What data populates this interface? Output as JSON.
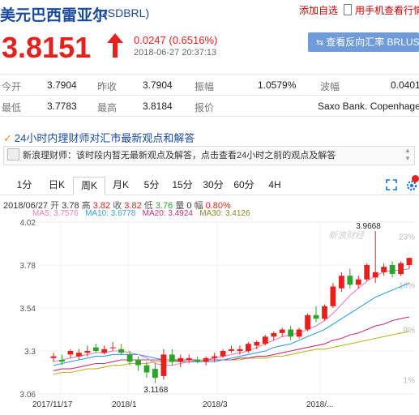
{
  "header": {
    "title": "美元巴西雷亚尔",
    "code": "(USDBRL)",
    "add_favorite": "添加自选",
    "mobile_view": "用手机查看行情"
  },
  "quote": {
    "price": "3.8151",
    "change": "0.0247 (0.6516%)",
    "time": "2018-06-27 20:37:13",
    "reverse_button": "查看反向汇率 BRLUSD"
  },
  "stats": {
    "open_label": "今开",
    "open": "3.7904",
    "prev_close_label": "昨收",
    "prev_close": "3.7904",
    "amplitude_label": "振幅",
    "amplitude": "1.0579%",
    "range_label": "波幅",
    "range": "0.0401",
    "low_label": "最低",
    "low": "3.7783",
    "high_label": "最高",
    "high": "3.8184",
    "quote_label": "报价",
    "quote_source": "Saxo Bank. Copenhager"
  },
  "news": {
    "title": "24小时内理财师对汇市最新观点和解答",
    "item": "新浪理财师：该时段内暂无最新观点及解答，点击查看24小时之前的观点及解答"
  },
  "tabs": [
    "1分",
    "日K",
    "周K",
    "月K",
    "5分",
    "15分",
    "30分",
    "60分",
    "4H"
  ],
  "active_tab": "周K",
  "chart_info": {
    "date": "2018/06/27",
    "open_label": "开",
    "open": "3.78",
    "high_label": "高",
    "high": "3.82",
    "close_label": "收",
    "close": "3.82",
    "low_label": "低",
    "low": "3.76",
    "volume_label": "量",
    "volume": "0",
    "change_label": "幅",
    "change": "0.80%",
    "ma5": "MA5: 3.7576",
    "ma10": "MA10: 3.6778",
    "ma20": "MA20: 3.4924",
    "ma30": "MA30: 3.4126"
  },
  "colors": {
    "up": "#e8201c",
    "down": "#2aa52a",
    "ma5": "#e87fbf",
    "ma10": "#3aa0e0",
    "ma20": "#c8307a",
    "ma30": "#b8b830",
    "link": "#1a4a9c"
  },
  "chart_data": {
    "type": "candlestick",
    "y_ticks": [
      "4.02",
      "3.78",
      "3.54",
      "3.3",
      "3.06"
    ],
    "y_range": [
      3.06,
      4.02
    ],
    "right_ticks": [
      "23%",
      "16%",
      "9%",
      "1%"
    ],
    "x_ticks": [
      "2017/11/17",
      "2018/1",
      "2018/3",
      "2018/..."
    ],
    "max_label": "3.9668",
    "min_label": "3.1168",
    "watermark": "新浪财经",
    "candles": [
      {
        "o": 3.26,
        "h": 3.29,
        "l": 3.24,
        "c": 3.27
      },
      {
        "o": 3.25,
        "h": 3.28,
        "l": 3.22,
        "c": 3.24
      },
      {
        "o": 3.28,
        "h": 3.31,
        "l": 3.26,
        "c": 3.3
      },
      {
        "o": 3.27,
        "h": 3.31,
        "l": 3.25,
        "c": 3.29
      },
      {
        "o": 3.29,
        "h": 3.33,
        "l": 3.27,
        "c": 3.3
      },
      {
        "o": 3.32,
        "h": 3.34,
        "l": 3.29,
        "c": 3.3
      },
      {
        "o": 3.29,
        "h": 3.33,
        "l": 3.28,
        "c": 3.31
      },
      {
        "o": 3.32,
        "h": 3.35,
        "l": 3.3,
        "c": 3.32
      },
      {
        "o": 3.31,
        "h": 3.34,
        "l": 3.28,
        "c": 3.29
      },
      {
        "o": 3.28,
        "h": 3.3,
        "l": 3.22,
        "c": 3.24
      },
      {
        "o": 3.25,
        "h": 3.27,
        "l": 3.19,
        "c": 3.22
      },
      {
        "o": 3.22,
        "h": 3.24,
        "l": 3.15,
        "c": 3.18
      },
      {
        "o": 3.2,
        "h": 3.23,
        "l": 3.12,
        "c": 3.15
      },
      {
        "o": 3.16,
        "h": 3.31,
        "l": 3.14,
        "c": 3.28
      },
      {
        "o": 3.28,
        "h": 3.31,
        "l": 3.22,
        "c": 3.24
      },
      {
        "o": 3.24,
        "h": 3.28,
        "l": 3.21,
        "c": 3.26
      },
      {
        "o": 3.25,
        "h": 3.28,
        "l": 3.23,
        "c": 3.26
      },
      {
        "o": 3.25,
        "h": 3.27,
        "l": 3.23,
        "c": 3.24
      },
      {
        "o": 3.24,
        "h": 3.27,
        "l": 3.22,
        "c": 3.26
      },
      {
        "o": 3.26,
        "h": 3.29,
        "l": 3.24,
        "c": 3.27
      },
      {
        "o": 3.27,
        "h": 3.31,
        "l": 3.26,
        "c": 3.3
      },
      {
        "o": 3.3,
        "h": 3.33,
        "l": 3.29,
        "c": 3.31
      },
      {
        "o": 3.3,
        "h": 3.33,
        "l": 3.28,
        "c": 3.31
      },
      {
        "o": 3.3,
        "h": 3.35,
        "l": 3.29,
        "c": 3.34
      },
      {
        "o": 3.33,
        "h": 3.36,
        "l": 3.31,
        "c": 3.35
      },
      {
        "o": 3.34,
        "h": 3.39,
        "l": 3.33,
        "c": 3.38
      },
      {
        "o": 3.38,
        "h": 3.41,
        "l": 3.36,
        "c": 3.4
      },
      {
        "o": 3.4,
        "h": 3.43,
        "l": 3.38,
        "c": 3.42
      },
      {
        "o": 3.42,
        "h": 3.44,
        "l": 3.36,
        "c": 3.38
      },
      {
        "o": 3.38,
        "h": 3.43,
        "l": 3.37,
        "c": 3.42
      },
      {
        "o": 3.42,
        "h": 3.51,
        "l": 3.41,
        "c": 3.5
      },
      {
        "o": 3.5,
        "h": 3.55,
        "l": 3.46,
        "c": 3.48
      },
      {
        "o": 3.48,
        "h": 3.56,
        "l": 3.47,
        "c": 3.55
      },
      {
        "o": 3.55,
        "h": 3.68,
        "l": 3.54,
        "c": 3.66
      },
      {
        "o": 3.65,
        "h": 3.74,
        "l": 3.63,
        "c": 3.72
      },
      {
        "o": 3.72,
        "h": 3.76,
        "l": 3.65,
        "c": 3.67
      },
      {
        "o": 3.67,
        "h": 3.72,
        "l": 3.65,
        "c": 3.7
      },
      {
        "o": 3.7,
        "h": 3.79,
        "l": 3.69,
        "c": 3.78
      },
      {
        "o": 3.71,
        "h": 3.97,
        "l": 3.68,
        "c": 3.74
      },
      {
        "o": 3.74,
        "h": 3.79,
        "l": 3.72,
        "c": 3.77
      },
      {
        "o": 3.78,
        "h": 3.8,
        "l": 3.71,
        "c": 3.73
      },
      {
        "o": 3.73,
        "h": 3.8,
        "l": 3.72,
        "c": 3.79
      },
      {
        "o": 3.78,
        "h": 3.82,
        "l": 3.76,
        "c": 3.82
      }
    ],
    "ma5": [
      3.24,
      3.25,
      3.26,
      3.27,
      3.28,
      3.29,
      3.29,
      3.3,
      3.3,
      3.29,
      3.28,
      3.26,
      3.23,
      3.22,
      3.22,
      3.23,
      3.24,
      3.25,
      3.25,
      3.26,
      3.27,
      3.28,
      3.29,
      3.3,
      3.32,
      3.34,
      3.36,
      3.38,
      3.39,
      3.4,
      3.42,
      3.44,
      3.47,
      3.51,
      3.56,
      3.61,
      3.65,
      3.69,
      3.72,
      3.74,
      3.75,
      3.75,
      3.76
    ],
    "ma10": [
      3.22,
      3.23,
      3.24,
      3.25,
      3.26,
      3.27,
      3.27,
      3.28,
      3.28,
      3.28,
      3.28,
      3.27,
      3.26,
      3.25,
      3.25,
      3.24,
      3.24,
      3.24,
      3.24,
      3.24,
      3.25,
      3.26,
      3.27,
      3.28,
      3.29,
      3.3,
      3.32,
      3.33,
      3.34,
      3.36,
      3.38,
      3.4,
      3.42,
      3.45,
      3.48,
      3.51,
      3.54,
      3.57,
      3.6,
      3.62,
      3.64,
      3.66,
      3.68
    ],
    "ma20": [
      3.19,
      3.2,
      3.2,
      3.21,
      3.22,
      3.23,
      3.23,
      3.24,
      3.25,
      3.25,
      3.25,
      3.25,
      3.25,
      3.25,
      3.25,
      3.25,
      3.25,
      3.25,
      3.25,
      3.25,
      3.25,
      3.25,
      3.26,
      3.26,
      3.27,
      3.27,
      3.28,
      3.29,
      3.3,
      3.31,
      3.32,
      3.33,
      3.34,
      3.36,
      3.37,
      3.39,
      3.4,
      3.42,
      3.44,
      3.45,
      3.47,
      3.48,
      3.49
    ],
    "ma30": [
      3.17,
      3.18,
      3.18,
      3.19,
      3.2,
      3.2,
      3.21,
      3.22,
      3.22,
      3.23,
      3.23,
      3.23,
      3.24,
      3.24,
      3.24,
      3.24,
      3.24,
      3.24,
      3.25,
      3.25,
      3.25,
      3.25,
      3.25,
      3.26,
      3.26,
      3.26,
      3.27,
      3.27,
      3.28,
      3.29,
      3.3,
      3.31,
      3.31,
      3.32,
      3.33,
      3.34,
      3.35,
      3.36,
      3.37,
      3.38,
      3.39,
      3.4,
      3.41
    ]
  }
}
